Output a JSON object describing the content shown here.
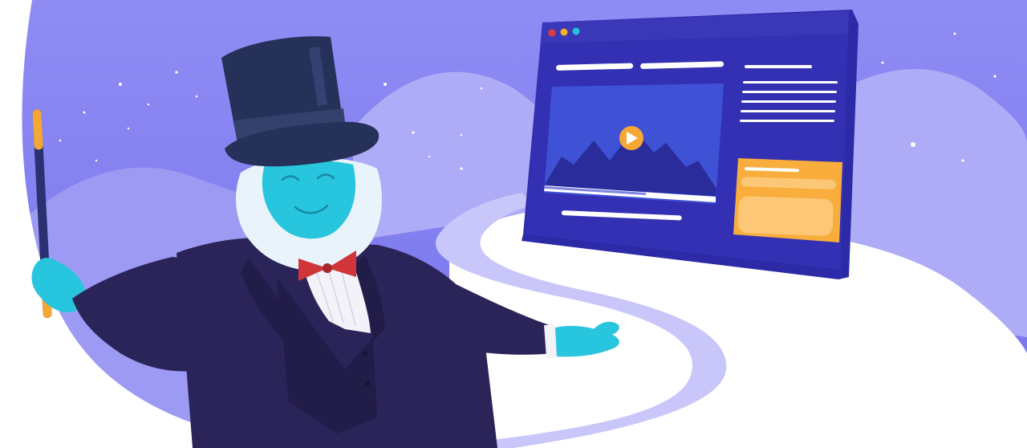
{
  "scene": {
    "colors": {
      "sky_top": "#8f8cf4",
      "sky_bottom": "#7673ec",
      "hill_light": "#aeacf6",
      "hill_mid": "#9d9af3",
      "snow": "#ffffff",
      "path": "#c9c7fa",
      "screen_frame": "#2c2aa6",
      "screen_bar": "#3a38b8",
      "screen_body": "#3330b4",
      "video_bg": "#3f52d6",
      "mountain": "#2a2c9c",
      "play": "#f7a733",
      "card": "#f8ad3d",
      "card_inner": "#fcc877",
      "suit": "#2b2459",
      "suit_shadow": "#211c48",
      "hat": "#253158",
      "hat_band": "#34416d",
      "face": "#27c5de",
      "fur": "#e8f3fb",
      "bowtie": "#d0353a",
      "wand": "#2b3170",
      "wand_tip": "#f3a735",
      "shirt": "#f2f2f8"
    },
    "dots": [
      "#e23c3c",
      "#f5b21e",
      "#22c3d9"
    ]
  }
}
